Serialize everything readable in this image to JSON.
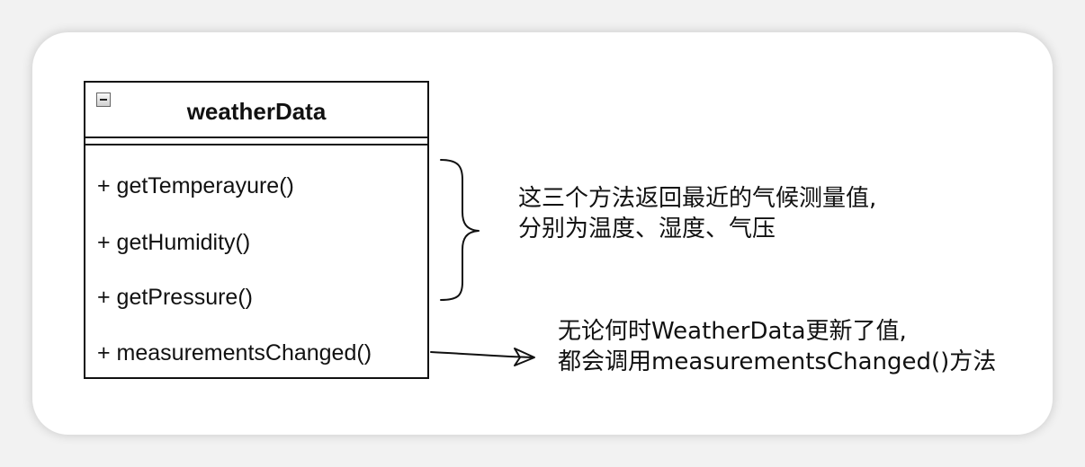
{
  "diagram": {
    "class": {
      "name": "weatherData",
      "methods": [
        "+ getTemperayure()",
        "+ getHumidity()",
        "+ getPressure()",
        "+ measurementsChanged()"
      ]
    },
    "notes": {
      "getters": [
        "这三个方法返回最近的气候测量值,",
        "分别为温度、湿度、气压"
      ],
      "measurements_changed": [
        "无论何时WeatherData更新了值,",
        "都会调用measurementsChanged()方法"
      ]
    }
  }
}
